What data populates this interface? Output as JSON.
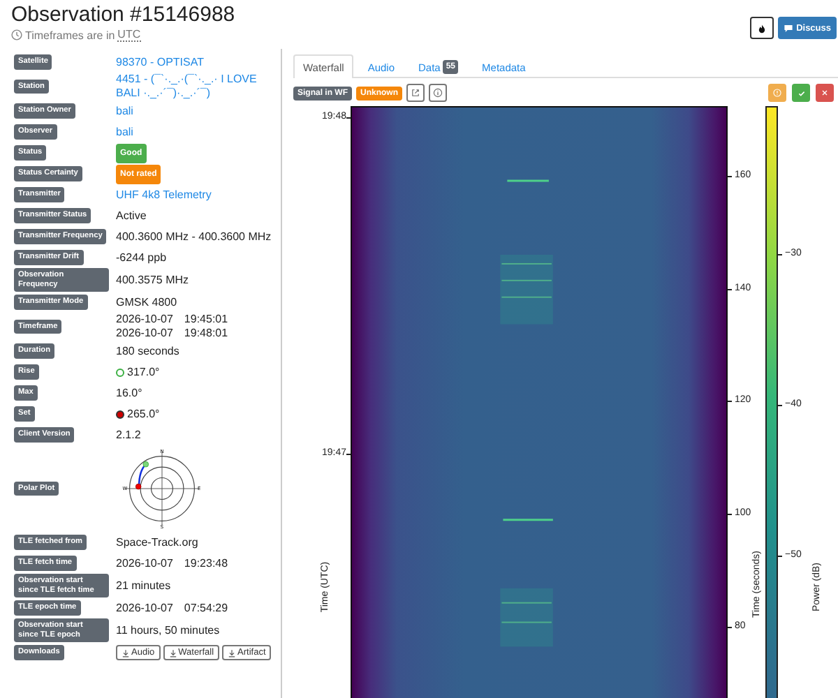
{
  "title": "Observation #15146988",
  "timeframes_note": {
    "text": "Timeframes are in",
    "zone": "UTC"
  },
  "discuss_button": "Discuss",
  "details": [
    {
      "label": "Satellite",
      "kind": "link",
      "value": "98370 - OPTISAT"
    },
    {
      "label": "Station",
      "kind": "link",
      "value": "4451 - (¯`·._.·(¯`·._.· I LOVE BALI ·._.·´¯)·._.·´¯)"
    },
    {
      "label": "Station Owner",
      "kind": "link",
      "value": "bali"
    },
    {
      "label": "Observer",
      "kind": "link",
      "value": "bali"
    },
    {
      "label": "Status",
      "kind": "badge",
      "value": "Good",
      "color": "#4cae4c"
    },
    {
      "label": "Status Certainty",
      "kind": "badge",
      "value": "Not rated",
      "color": "#f5870a"
    },
    {
      "label": "Transmitter",
      "kind": "link",
      "value": "UHF 4k8 Telemetry"
    },
    {
      "label": "Transmitter Status",
      "kind": "text",
      "value": "Active"
    },
    {
      "label": "Transmitter Frequency",
      "kind": "text",
      "value": "400.3600 MHz - 400.3600 MHz"
    },
    {
      "label": "Transmitter Drift",
      "kind": "text",
      "value": "-6244 ppb"
    },
    {
      "label": "Observation Frequency",
      "kind": "text",
      "value": "400.3575 MHz"
    },
    {
      "label": "Transmitter Mode",
      "kind": "text",
      "value": "GMSK 4800"
    },
    {
      "label": "Timeframe",
      "kind": "datetimes",
      "lines": [
        {
          "date": "2026-10-07",
          "time": "19:45:01"
        },
        {
          "date": "2026-10-07",
          "time": "19:48:01"
        }
      ]
    },
    {
      "label": "Duration",
      "kind": "text",
      "value": "180 seconds"
    },
    {
      "label": "Rise",
      "kind": "dot",
      "value": "317.0°",
      "color": "#3cb043",
      "filled": false
    },
    {
      "label": "Max",
      "kind": "text",
      "value": "16.0°"
    },
    {
      "label": "Set",
      "kind": "dot",
      "value": "265.0°",
      "color": "#cc0000",
      "filled": true
    },
    {
      "label": "Client Version",
      "kind": "text",
      "value": "2.1.2"
    },
    {
      "label": "Polar Plot",
      "kind": "polar",
      "directions": [
        "N",
        "E",
        "S",
        "W"
      ]
    },
    {
      "label": "TLE fetched from",
      "kind": "text",
      "value": "Space-Track.org"
    },
    {
      "label": "TLE fetch time",
      "kind": "datetimes",
      "lines": [
        {
          "date": "2026-10-07",
          "time": "19:23:48"
        }
      ]
    },
    {
      "label": "Observation start since TLE fetch time",
      "kind": "text",
      "value": "21 minutes"
    },
    {
      "label": "TLE epoch time",
      "kind": "datetimes",
      "lines": [
        {
          "date": "2026-10-07",
          "time": "07:54:29"
        }
      ]
    },
    {
      "label": "Observation start since TLE epoch",
      "kind": "text",
      "value": "11 hours, 50 minutes"
    },
    {
      "label": "Downloads",
      "kind": "downloads",
      "buttons": [
        "Audio",
        "Waterfall",
        "Artifact"
      ]
    }
  ],
  "tabs": [
    {
      "label": "Waterfall",
      "selected": true
    },
    {
      "label": "Audio",
      "selected": false
    },
    {
      "label": "Data",
      "count": "55",
      "selected": false
    },
    {
      "label": "Metadata",
      "selected": false
    }
  ],
  "signal_badge": "Signal in WF",
  "status_badge": "Unknown",
  "plot": {
    "left_ticks": [
      "19:48",
      "19:47"
    ],
    "left_label": "Time (UTC)",
    "right_ticks": [
      "160",
      "140",
      "120",
      "100",
      "80"
    ],
    "right_label": "Time (seconds)",
    "colorbar_ticks": [
      "−30",
      "−40",
      "−50"
    ],
    "colorbar_label": "Power (dB)"
  }
}
